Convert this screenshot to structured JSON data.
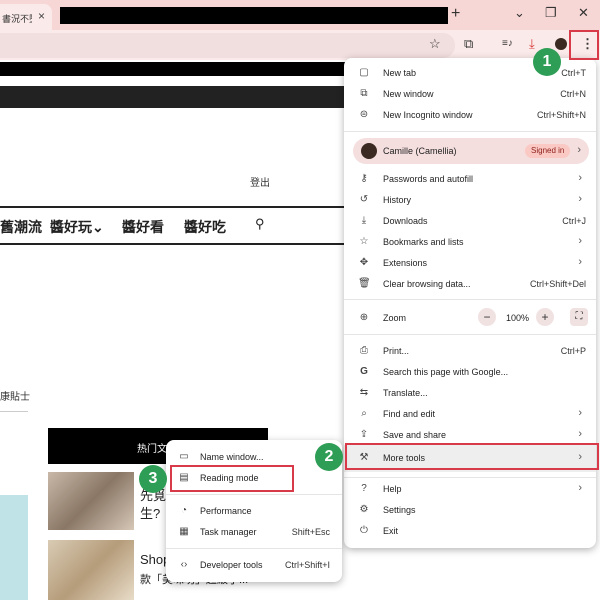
{
  "tab": {
    "title": "書況不墮",
    "close": "×"
  },
  "window": {
    "new_tab": "+",
    "minimize": "⌄",
    "restore": "❐",
    "close": "✕"
  },
  "toolbar": {
    "star_icon": "☆",
    "extension_icon": "⧉",
    "media_icon": "≡♪",
    "download_icon": "⤓",
    "menu_icon": "⋮"
  },
  "page": {
    "logout": "登出",
    "nav": [
      "舊潮流",
      "醬好玩⌄",
      "醬好看",
      "醬好吃"
    ],
    "health": "康貼士",
    "hot_label": "热门文",
    "article1": [
      "先覓",
      "生?"
    ],
    "article2": [
      "Shop",
      "款「美味功」超級了..."
    ]
  },
  "menu": {
    "items_top": [
      {
        "icon": "▢",
        "label": "New tab",
        "shortcut": "Ctrl+T"
      },
      {
        "icon": "⧉",
        "label": "New window",
        "shortcut": "Ctrl+N"
      },
      {
        "icon": "⊜",
        "label": "New Incognito window",
        "shortcut": "Ctrl+Shift+N"
      }
    ],
    "profile": {
      "name": "Camille (Camellia)",
      "status": "Signed in"
    },
    "items_mid": [
      {
        "icon": "⚷",
        "label": "Passwords and autofill",
        "arrow": "›"
      },
      {
        "icon": "↺",
        "label": "History",
        "arrow": "›"
      },
      {
        "icon": "⤓",
        "label": "Downloads",
        "shortcut": "Ctrl+J"
      },
      {
        "icon": "☆",
        "label": "Bookmarks and lists",
        "arrow": "›"
      },
      {
        "icon": "✥",
        "label": "Extensions",
        "arrow": "›"
      },
      {
        "icon": "🗑",
        "label": "Clear browsing data...",
        "shortcut": "Ctrl+Shift+Del"
      }
    ],
    "zoom": {
      "icon": "⊕",
      "label": "Zoom",
      "minus": "−",
      "value": "100%",
      "plus": "+",
      "fullscreen": "⛶"
    },
    "items_bottom": [
      {
        "icon": "⎙",
        "label": "Print...",
        "shortcut": "Ctrl+P"
      },
      {
        "icon": "G",
        "label": "Search this page with Google..."
      },
      {
        "icon": "⇆",
        "label": "Translate..."
      },
      {
        "icon": "⌕",
        "label": "Find and edit",
        "arrow": "›"
      },
      {
        "icon": "⇪",
        "label": "Save and share",
        "arrow": "›"
      },
      {
        "icon": "⚒",
        "label": "More tools",
        "arrow": "›"
      }
    ],
    "items_end": [
      {
        "icon": "?",
        "label": "Help",
        "arrow": "›"
      },
      {
        "icon": "⚙",
        "label": "Settings"
      },
      {
        "icon": "⏻",
        "label": "Exit"
      }
    ]
  },
  "submenu": {
    "items": [
      {
        "icon": "▭",
        "label": "Name window..."
      },
      {
        "icon": "▤",
        "label": "Reading mode"
      },
      {
        "icon": "◔",
        "label": "Performance"
      },
      {
        "icon": "▦",
        "label": "Task manager",
        "shortcut": "Shift+Esc"
      },
      {
        "icon": "‹›",
        "label": "Developer tools",
        "shortcut": "Ctrl+Shift+I"
      }
    ]
  },
  "annotations": {
    "step1": "1",
    "step2": "2",
    "step3": "3",
    "accent": "#d93a4a",
    "badge_color": "#2e9d55"
  }
}
